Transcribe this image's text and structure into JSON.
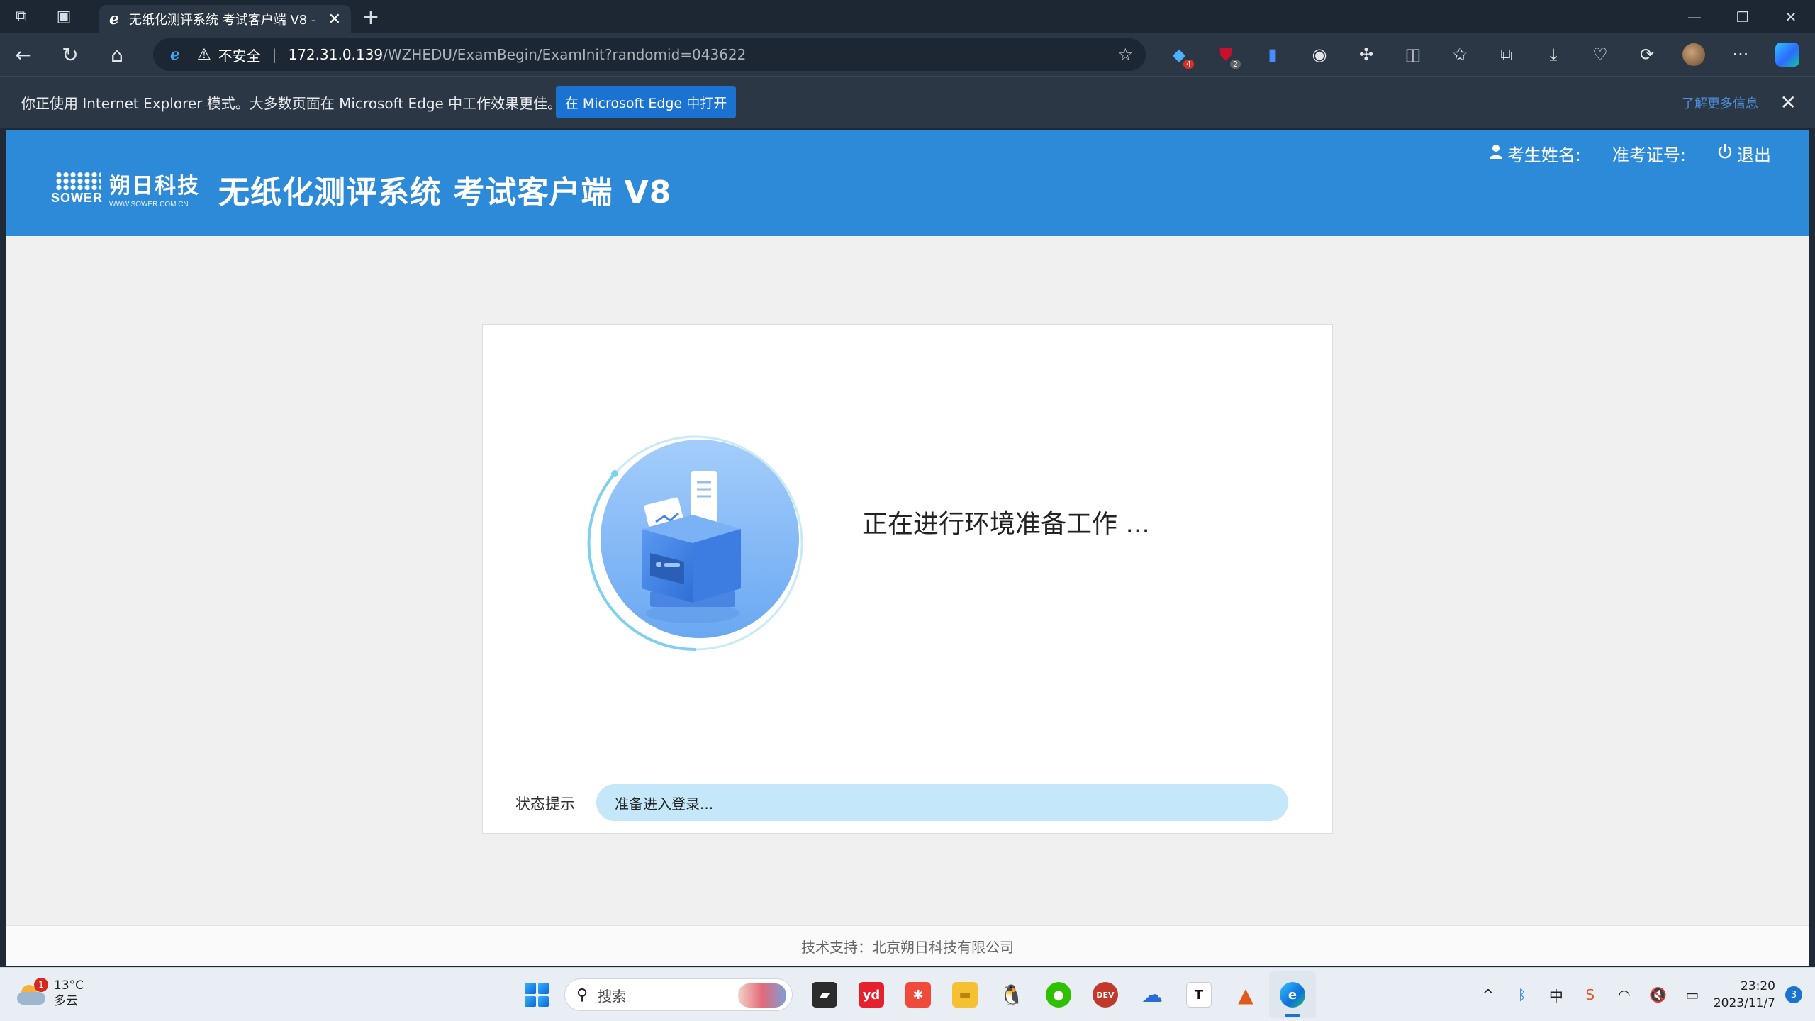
{
  "browser": {
    "tab": {
      "title": "无纸化测评系统 考试客户端 V8 -",
      "icon": "ie-mode-icon"
    },
    "security_text": "不安全",
    "url_host": "172.31.0.139",
    "url_path": "/WZHEDU/ExamBegin/ExamInit?randomid=043622",
    "extension_badges": {
      "ext1": "4",
      "ext2": "2"
    }
  },
  "infobar": {
    "message": "你正使用 Internet Explorer 模式。大多数页面在 Microsoft Edge 中工作效果更佳。",
    "open_button": "在 Microsoft Edge 中打开",
    "learn_more": "了解更多信息"
  },
  "app": {
    "logo_cn": "朔日科技",
    "logo_en": "WWW.SOWER.COM.CN",
    "logo_brand": "SOWER",
    "title": "无纸化测评系统 考试客户端 V8",
    "student_name_label": "考生姓名:",
    "ticket_label": "准考证号:",
    "logout": "退出",
    "colors": {
      "header": "#2d8ad8",
      "status_bar": "#c5e7fa"
    }
  },
  "card": {
    "message": "正在进行环境准备工作 ...",
    "status_label": "状态提示",
    "status_text": "准备进入登录..."
  },
  "footer": {
    "text": "技术支持：北京朔日科技有限公司"
  },
  "taskbar": {
    "weather": {
      "temp": "13°C",
      "desc": "多云",
      "badge": "1"
    },
    "search_placeholder": "搜索",
    "apps": [
      "file-manager-icon",
      "youdao-icon",
      "xmind-icon",
      "folder-icon",
      "qq-icon",
      "wechat-icon",
      "devcpp-icon",
      "onedrive-icon",
      "typora-icon",
      "matlab-icon",
      "edge-icon"
    ],
    "ime": "中",
    "time": "23:20",
    "date": "2023/11/7",
    "notifications": "3"
  }
}
